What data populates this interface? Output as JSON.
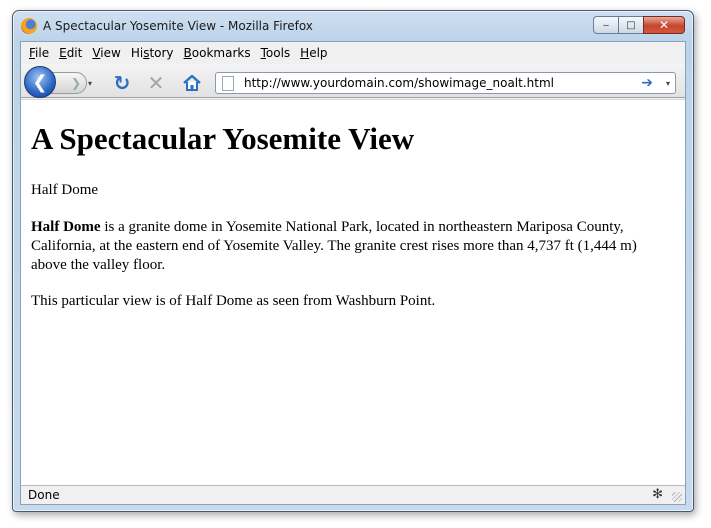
{
  "window": {
    "title": "A Spectacular Yosemite View - Mozilla Firefox",
    "buttons": {
      "minimize": "‒",
      "maximize": "□",
      "close": "✕"
    }
  },
  "menubar": {
    "items": [
      {
        "pre": "",
        "key": "F",
        "post": "ile"
      },
      {
        "pre": "",
        "key": "E",
        "post": "dit"
      },
      {
        "pre": "",
        "key": "V",
        "post": "iew"
      },
      {
        "pre": "Hi",
        "key": "s",
        "post": "tory"
      },
      {
        "pre": "",
        "key": "B",
        "post": "ookmarks"
      },
      {
        "pre": "",
        "key": "T",
        "post": "ools"
      },
      {
        "pre": "",
        "key": "H",
        "post": "elp"
      }
    ]
  },
  "navbar": {
    "back_glyph": "❮",
    "forward_glyph": "❯",
    "reload_glyph": "↻",
    "stop_glyph": "✕",
    "url": "http://www.yourdomain.com/showimage_noalt.html",
    "go_glyph": "➔",
    "dropdown_glyph": "▾",
    "accent": "#2c6fc4"
  },
  "page": {
    "heading": "A Spectacular Yosemite View",
    "caption": "Half Dome",
    "para_bold": "Half Dome",
    "para_rest": " is a granite dome in Yosemite National Park, located in northeastern Mariposa County, California, at the eastern end of Yosemite Valley. The granite crest rises more than 4,737 ft (1,444 m) above the valley floor.",
    "para2": "This particular view is of Half Dome as seen from Washburn Point."
  },
  "status": {
    "text": "Done",
    "addon_glyph": "✻"
  }
}
